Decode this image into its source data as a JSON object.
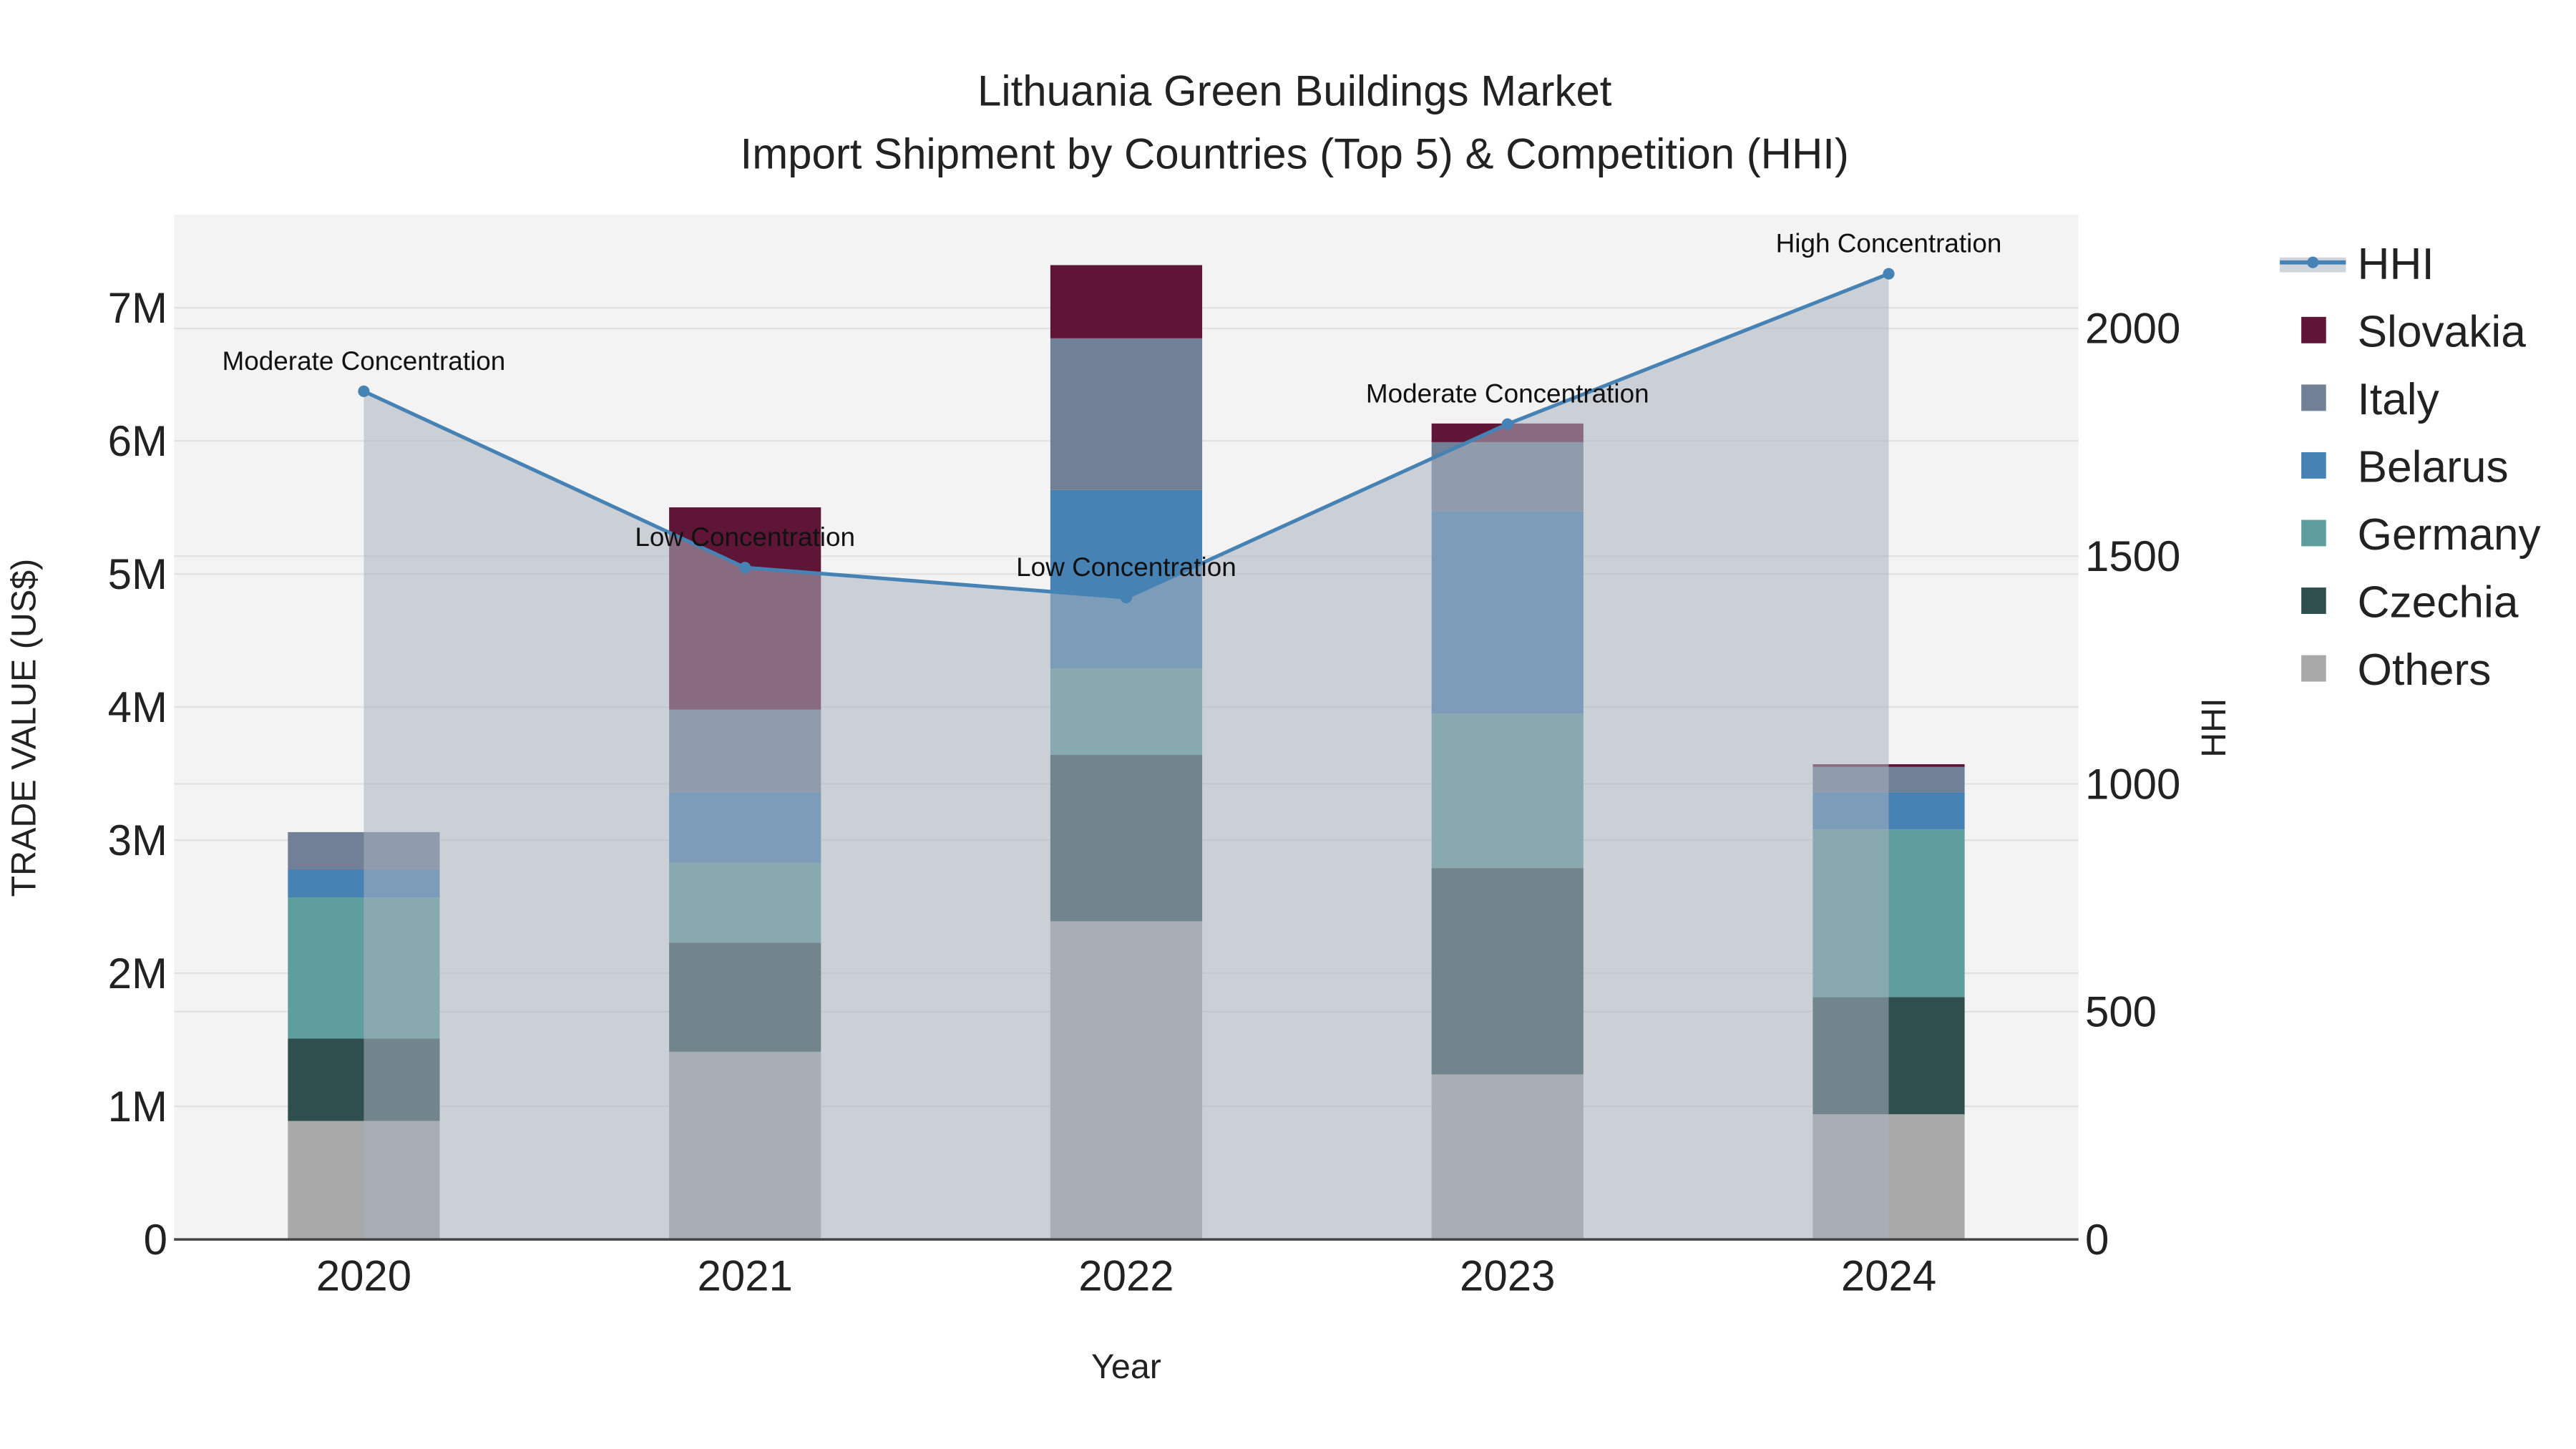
{
  "chart_data": {
    "type": "bar",
    "title_line1": "Lithuania Green Buildings Market",
    "title_line2": "Import Shipment by Countries (Top 5) & Competition (HHI)",
    "xlabel": "Year",
    "ylabel": "TRADE VALUE (US$)",
    "y2label": "HHI",
    "categories": [
      "2020",
      "2021",
      "2022",
      "2023",
      "2024"
    ],
    "ylim": [
      0,
      7700000
    ],
    "y2lim": [
      0,
      2250
    ],
    "yticks": [
      {
        "v": 0,
        "label": "0"
      },
      {
        "v": 1000000,
        "label": "1M"
      },
      {
        "v": 2000000,
        "label": "2M"
      },
      {
        "v": 3000000,
        "label": "3M"
      },
      {
        "v": 4000000,
        "label": "4M"
      },
      {
        "v": 5000000,
        "label": "5M"
      },
      {
        "v": 6000000,
        "label": "6M"
      },
      {
        "v": 7000000,
        "label": "7M"
      }
    ],
    "y2ticks": [
      {
        "v": 0,
        "label": "0"
      },
      {
        "v": 500,
        "label": "500"
      },
      {
        "v": 1000,
        "label": "1000"
      },
      {
        "v": 1500,
        "label": "1500"
      },
      {
        "v": 2000,
        "label": "2000"
      }
    ],
    "series": [
      {
        "name": "Others",
        "color": "#a9a9a9",
        "values": [
          890000,
          1410000,
          2390000,
          1240000,
          940000
        ]
      },
      {
        "name": "Czechia",
        "color": "#2f4f4f",
        "values": [
          620000,
          820000,
          1250000,
          1550000,
          880000
        ]
      },
      {
        "name": "Germany",
        "color": "#5f9e9e",
        "values": [
          1060000,
          600000,
          650000,
          1160000,
          1260000
        ]
      },
      {
        "name": "Belarus",
        "color": "#4682b4",
        "values": [
          210000,
          530000,
          1340000,
          1520000,
          280000
        ]
      },
      {
        "name": "Italy",
        "color": "#718096",
        "values": [
          280000,
          620000,
          1140000,
          520000,
          190000
        ]
      },
      {
        "name": "Slovakia",
        "color": "#5f1536",
        "values": [
          0,
          1520000,
          550000,
          140000,
          20000
        ]
      }
    ],
    "hhi": {
      "name": "HHI",
      "color": "#4682b4",
      "values": [
        1862,
        1475,
        1409,
        1790,
        2120
      ],
      "annotations": [
        "Moderate Concentration",
        "Low Concentration",
        "Low Concentration",
        "Moderate Concentration",
        "High Concentration"
      ]
    },
    "legend_order": [
      "HHI",
      "Slovakia",
      "Italy",
      "Belarus",
      "Germany",
      "Czechia",
      "Others"
    ],
    "legend_placement": "right"
  }
}
